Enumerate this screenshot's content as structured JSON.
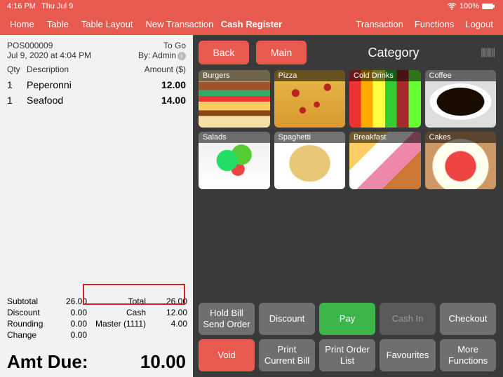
{
  "status": {
    "time": "4:16 PM",
    "date": "Thu Jul 9",
    "battery": "100%"
  },
  "nav": {
    "home": "Home",
    "table": "Table",
    "table_layout": "Table Layout",
    "new_transaction": "New Transaction",
    "title": "Cash Register",
    "transaction": "Transaction",
    "functions": "Functions",
    "logout": "Logout"
  },
  "receipt": {
    "order_no": "POS000009",
    "order_type": "To Go",
    "datetime": "Jul 9, 2020 at 4:04 PM",
    "by_label": "By: Admin",
    "col_qty": "Qty",
    "col_desc": "Description",
    "col_amount": "Amount ($)",
    "items": [
      {
        "qty": "1",
        "desc": "Peperonni",
        "amount": "12.00"
      },
      {
        "qty": "1",
        "desc": "Seafood",
        "amount": "14.00"
      }
    ],
    "labels": {
      "subtotal": "Subtotal",
      "discount": "Discount",
      "rounding": "Rounding",
      "change": "Change",
      "total": "Total",
      "cash": "Cash",
      "master": "Master (1111)"
    },
    "values": {
      "subtotal": "26.00",
      "discount": "0.00",
      "rounding": "0.00",
      "change": "0.00",
      "total": "26.00",
      "cash": "12.00",
      "master": "4.00"
    },
    "amt_due_label": "Amt Due:",
    "amt_due": "10.00"
  },
  "right": {
    "back": "Back",
    "main": "Main",
    "category": "Category",
    "cats": [
      {
        "label": "Burgers"
      },
      {
        "label": "Pizza"
      },
      {
        "label": "Cold Drinks"
      },
      {
        "label": "Coffee"
      },
      {
        "label": "Salads"
      },
      {
        "label": "Spaghetti"
      },
      {
        "label": "Breakfast"
      },
      {
        "label": "Cakes"
      }
    ],
    "actions": {
      "hold": "Hold Bill\nSend Order",
      "discount": "Discount",
      "pay": "Pay",
      "cashin": "Cash In",
      "checkout": "Checkout",
      "void": "Void",
      "print_bill": "Print\nCurrent Bill",
      "print_list": "Print Order\nList",
      "favourites": "Favourites",
      "more": "More\nFunctions"
    }
  }
}
